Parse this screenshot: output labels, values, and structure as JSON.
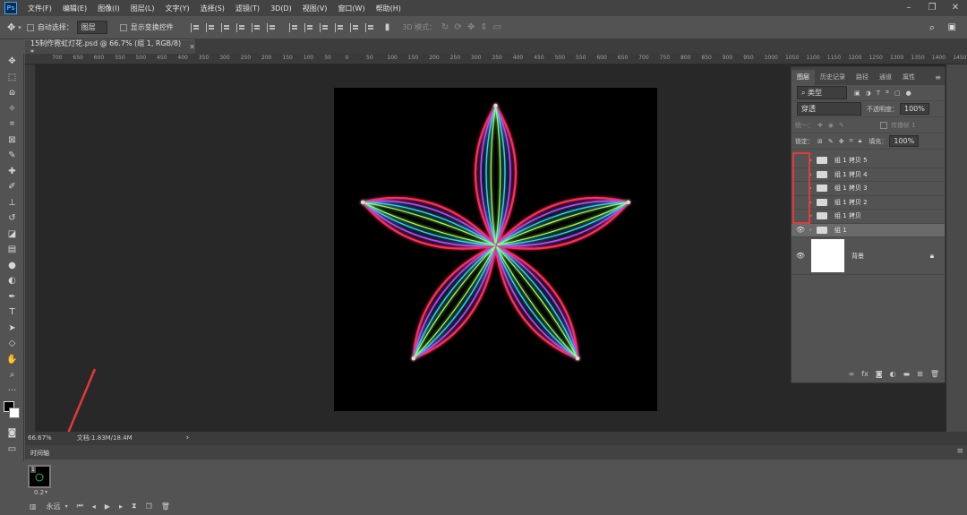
{
  "menubar": {
    "logo": "Ps",
    "items": [
      "文件(F)",
      "编辑(E)",
      "图像(I)",
      "图层(L)",
      "文字(Y)",
      "选择(S)",
      "滤镜(T)",
      "3D(D)",
      "视图(V)",
      "窗口(W)",
      "帮助(H)"
    ],
    "window_controls": [
      "–",
      "❐",
      "✕"
    ]
  },
  "options": {
    "auto_select_label": "自动选择：",
    "auto_select_value": "图层",
    "show_transform_label": "显示变换控件",
    "mode_3d_label": "3D 模式："
  },
  "document": {
    "tab_title": "15制作霓虹灯花.psd @ 66.7% (组 1, RGB/8) *",
    "tab_close": "✕"
  },
  "ruler": {
    "h_ticks": [
      "700",
      "650",
      "600",
      "550",
      "500",
      "450",
      "400",
      "350",
      "300",
      "250",
      "200",
      "150",
      "100",
      "50",
      "0",
      "50",
      "100",
      "150",
      "200",
      "250",
      "300",
      "350",
      "400",
      "450",
      "500",
      "550",
      "600",
      "650",
      "700",
      "750",
      "800",
      "850",
      "900",
      "950",
      "1000",
      "1050",
      "1100",
      "1150",
      "1200",
      "1250",
      "1300",
      "1350",
      "1400",
      "1450",
      "1500"
    ]
  },
  "status": {
    "zoom": "66.67%",
    "doc_info": "文档:1.83M/18.4M",
    "arrow": "›"
  },
  "layers_panel": {
    "tabs": [
      "图层",
      "历史记录",
      "路径",
      "通道",
      "属性"
    ],
    "filter_label": "类型",
    "blend_mode": "穿透",
    "opacity_label": "不透明度：",
    "opacity_value": "100%",
    "unify_label": "统一：",
    "propagate_label": "传播帧 1",
    "lock_label": "锁定：",
    "fill_label": "填充：",
    "fill_value": "100%",
    "layers": [
      {
        "name": "组 1 拷贝 5",
        "visible": false
      },
      {
        "name": "组 1 拷贝 4",
        "visible": false
      },
      {
        "name": "组 1 拷贝 3",
        "visible": false
      },
      {
        "name": "组 1 拷贝 2",
        "visible": false
      },
      {
        "name": "组 1 拷贝",
        "visible": false
      },
      {
        "name": "组 1",
        "visible": true
      }
    ],
    "background_layer": "背景",
    "highlight_color": "#e53935"
  },
  "timeline": {
    "tab_label": "时间轴",
    "frame_number": "1",
    "frame_delay": "0.2",
    "loop_label": "永远"
  },
  "colors": {
    "accent": "#31a8ff",
    "annotation_arrow": "#e53935"
  }
}
